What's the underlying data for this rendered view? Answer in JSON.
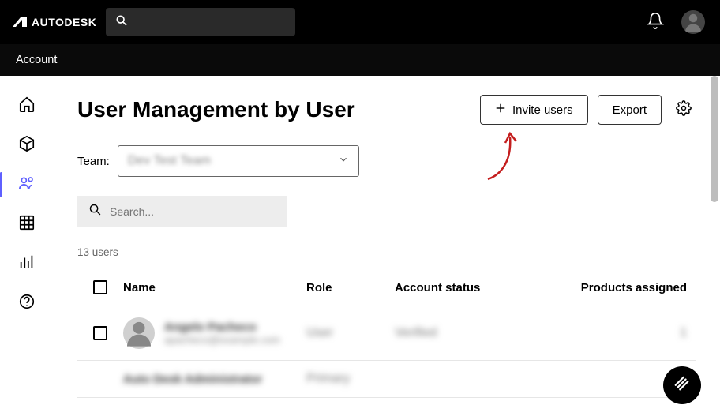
{
  "brand": "AUTODESK",
  "nav": {
    "account": "Account"
  },
  "header": {
    "title": "User Management by User",
    "invite_label": "Invite users",
    "export_label": "Export"
  },
  "team_filter": {
    "label": "Team:",
    "selected_value": "Dev Test Team"
  },
  "search": {
    "placeholder": "Search..."
  },
  "user_count_text": "13 users",
  "table": {
    "columns": {
      "name": "Name",
      "role": "Role",
      "status": "Account status",
      "products": "Products assigned"
    },
    "rows": [
      {
        "name": "Angelo Pacheco",
        "email": "apacheco@example.com",
        "role": "User",
        "status": "Verified",
        "products": "1"
      },
      {
        "name": "Auto Desk Administrator",
        "email": "",
        "role": "Primary",
        "status": "",
        "products": ""
      }
    ]
  }
}
